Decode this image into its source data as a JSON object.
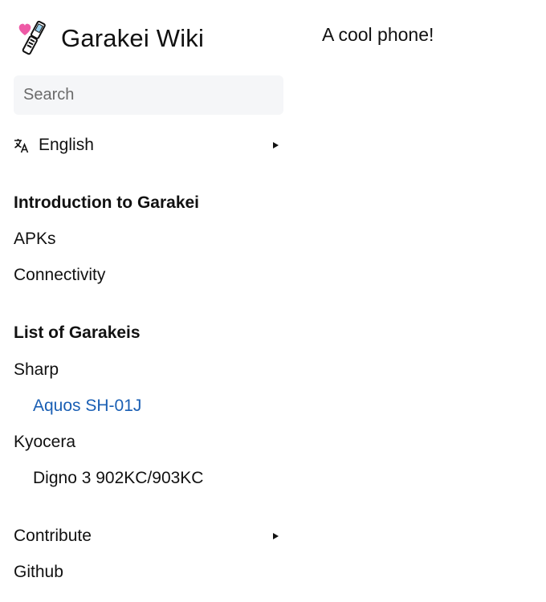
{
  "site": {
    "title": "Garakei Wiki",
    "logo_icon": "flip-phone-heart-icon"
  },
  "search": {
    "placeholder": "Search"
  },
  "language": {
    "label": "English",
    "icon": "translate-icon"
  },
  "nav": {
    "intro_heading": "Introduction to Garakei",
    "apks": "APKs",
    "connectivity": "Connectivity",
    "list_heading": "List of Garakeis",
    "sharp": "Sharp",
    "aquos": "Aquos SH-01J",
    "kyocera": "Kyocera",
    "digno": "Digno 3 902KC/903KC",
    "contribute": "Contribute",
    "github": "Github"
  },
  "content": {
    "text": "A cool phone!"
  },
  "colors": {
    "active_link": "#1a5fb4",
    "search_bg": "#f5f6f8"
  }
}
